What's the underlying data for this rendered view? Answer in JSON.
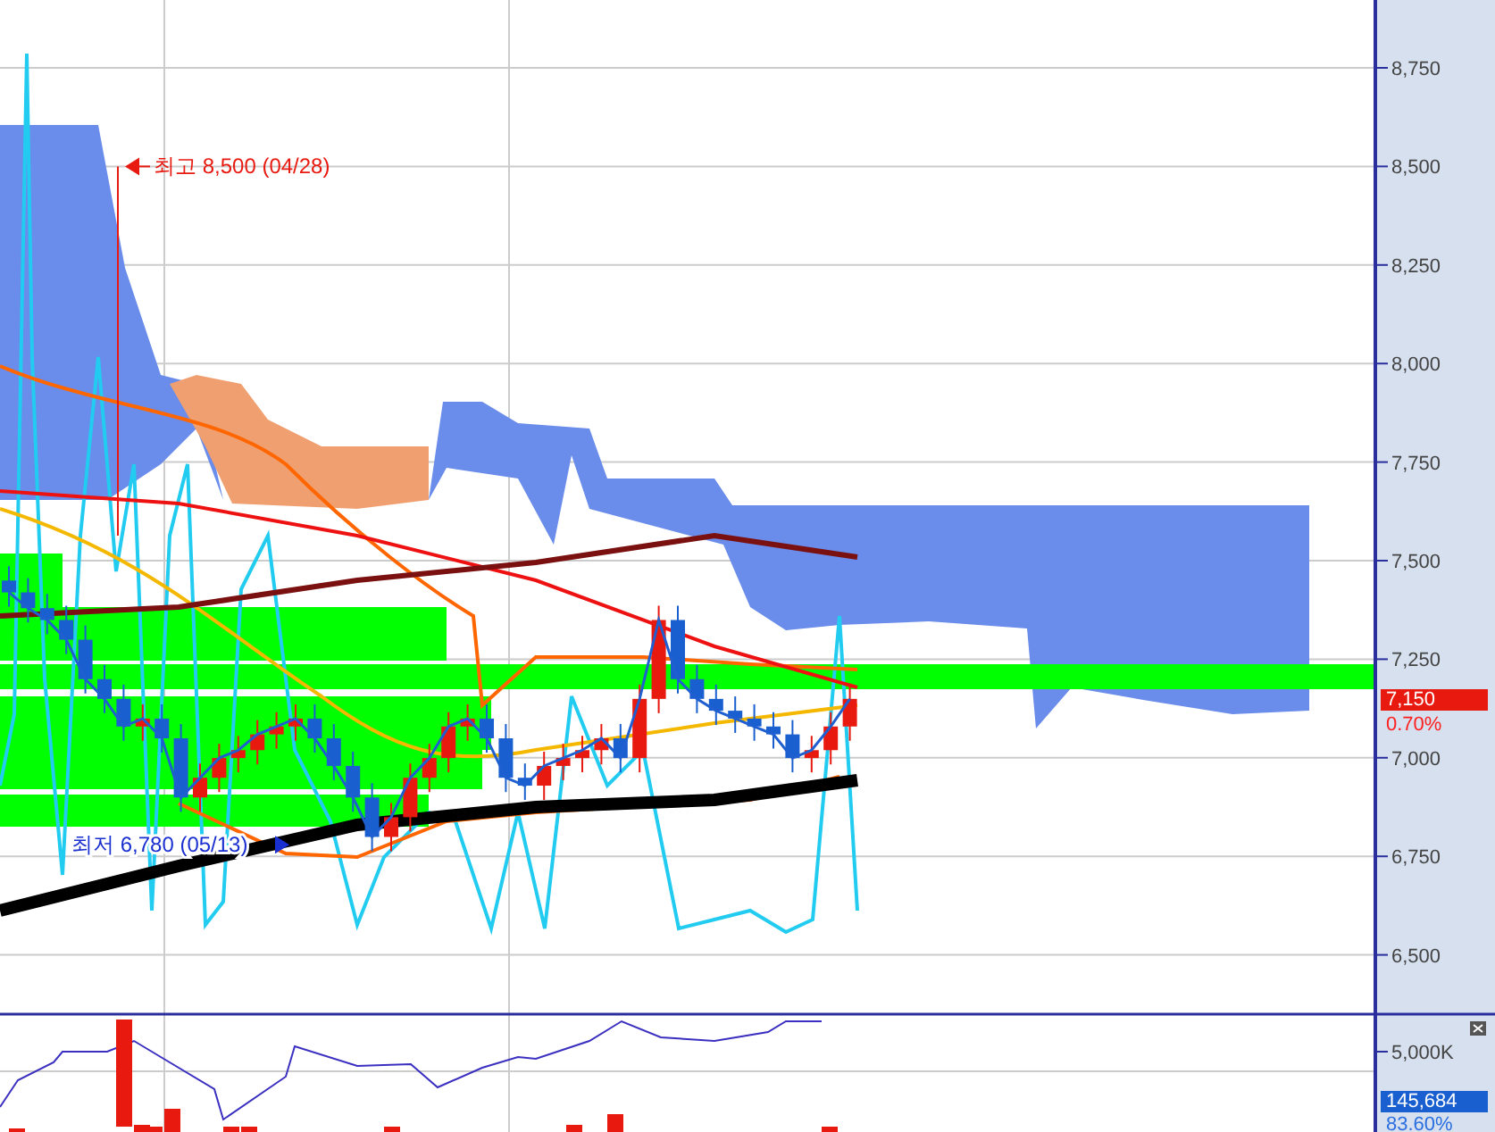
{
  "price_panel": {
    "axis_labels": [
      "8,750",
      "8,500",
      "8,250",
      "8,000",
      "7,750",
      "7,500",
      "7,250",
      "7,000",
      "6,750",
      "6,500"
    ],
    "high_marker": "최고 8,500 (04/28)",
    "low_marker": "최저 6,780 (05/13)",
    "price_badge": "7,150",
    "change": "0.70%"
  },
  "volume_panel": {
    "tick": "5,000K",
    "value_badge": "145,684",
    "ratio": "83.60%"
  }
}
